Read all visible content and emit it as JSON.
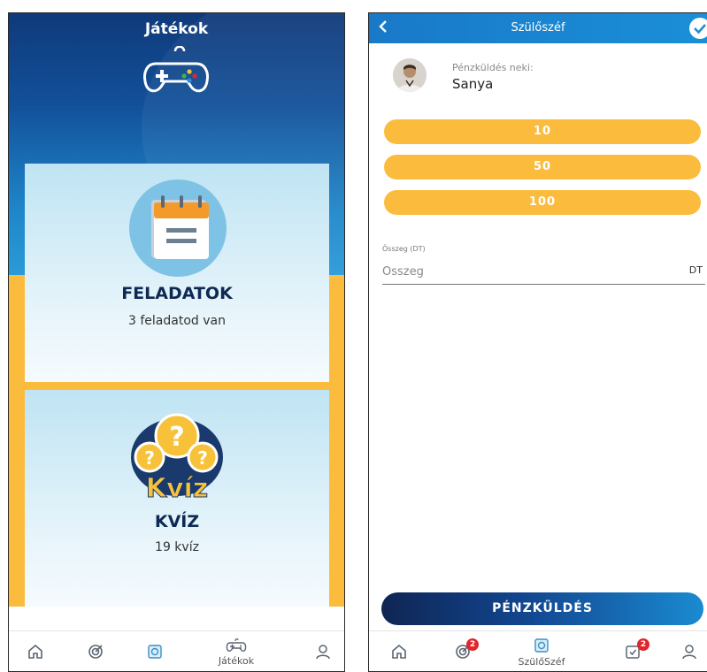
{
  "games_screen": {
    "title": "Játékok",
    "cards": [
      {
        "title": "FELADATOK",
        "subtitle": "3 feladatod van"
      },
      {
        "title": "KVÍZ",
        "subtitle": "19 kvíz",
        "logo_text": "Kvíz"
      }
    ],
    "tabbar": {
      "items": [
        {
          "icon": "home-icon",
          "label": ""
        },
        {
          "icon": "target-icon",
          "label": ""
        },
        {
          "icon": "safe-icon",
          "label": ""
        },
        {
          "icon": "gamepad-icon",
          "label": "Játékok",
          "active": true
        },
        {
          "icon": "profile-icon",
          "label": ""
        }
      ]
    }
  },
  "transfer_screen": {
    "title": "Szülőszéf",
    "recipient_label": "Pénzküldés neki:",
    "recipient_name": "Sanya",
    "amount_options": [
      "10",
      "50",
      "100"
    ],
    "amount_field": {
      "label": "Összeg (DT)",
      "placeholder": "Összeg",
      "unit": "DT"
    },
    "send_button": "PÉNZKÜLDÉS",
    "tabbar": {
      "items": [
        {
          "icon": "home-icon",
          "label": ""
        },
        {
          "icon": "target-icon",
          "label": "",
          "badge": "2"
        },
        {
          "icon": "safe-icon",
          "label": "SzülőSzéf",
          "active": true
        },
        {
          "icon": "tasks-icon",
          "label": "",
          "badge": "2"
        },
        {
          "icon": "profile-icon",
          "label": ""
        }
      ]
    }
  },
  "colors": {
    "accent_yellow": "#fbbc3e",
    "header_blue": "#1a8fd7",
    "dark_navy": "#0f2a52",
    "badge_red": "#e0262b"
  }
}
